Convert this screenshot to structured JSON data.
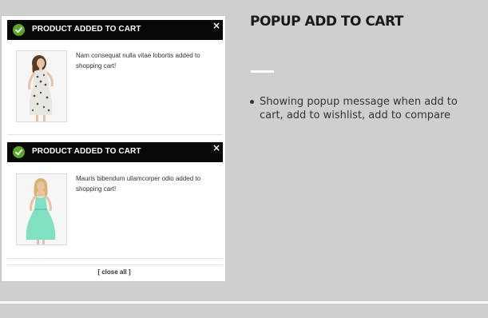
{
  "popups": [
    {
      "title": "PRODUCT ADDED TO CART",
      "close_symbol": "×",
      "message": "Nam consequat nulla vitae lobortis added to shopping cart!",
      "product_image": "woman-in-floral-dress"
    },
    {
      "title": "PRODUCT ADDED TO CART",
      "close_symbol": "×",
      "message": "Mauris bibendum ullamcorper odio added to shopping cart!",
      "product_image": "woman-in-mint-dress"
    }
  ],
  "close_all_label": "[ close all ]",
  "section": {
    "title": "POPUP ADD TO CART",
    "bullets": [
      "Showing popup message when add to cart, add to wishlist, add to compare"
    ]
  },
  "colors": {
    "background": "#d0cfcd",
    "header_bar": "#080808",
    "check_green": "#5aa829",
    "panel": "#ffffff"
  },
  "icons": {
    "success": "check-circle-icon",
    "close": "close-icon"
  }
}
